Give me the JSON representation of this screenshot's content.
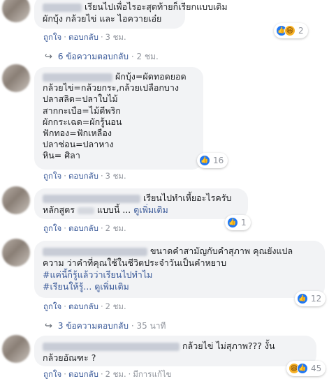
{
  "comments": [
    {
      "lines": [
        "เรียนไปเพื่อไรอะสุดท้ายก็เรียกแบบเดิม",
        "ผักบุ้ง กล้วยไข่ และ ไอควายเอ๋ย"
      ],
      "reactions": {
        "count": "2",
        "icons": [
          "like-icon",
          "haha-icon"
        ]
      },
      "meta": {
        "like": "ถูกใจ",
        "reply": "ตอบกลับ",
        "time": "3 ชม."
      }
    },
    {
      "lines": [
        "ผักบุ้ง=ผัดทอดยอด",
        "กล้วยไข่=กล้วยกระ,กล้วยเปลือกบาง",
        "ปลาสลิด=ปลาใบไม้",
        "สากกะเบือ=ไม้ตีพริก",
        "ผักกระเฉด=ผักรู้นอน",
        "ฟักทอง=ฟักเหลือง",
        "ปลาช่อน=ปลาหาง",
        "หิน= ศิลา"
      ],
      "reactions": {
        "count": "16",
        "icons": [
          "like-icon"
        ]
      },
      "meta": {
        "like": "ถูกใจ",
        "reply": "ตอบกลับ",
        "time": "3 ชม."
      }
    },
    {
      "lines": [
        "เรียนไปทำเหี้ยอะไรครับ",
        "หลักสูตร",
        "แบบนี้ ...",
        "ดูเพิ่มเติม"
      ],
      "reactions": {
        "count": "1",
        "icons": [
          "like-icon"
        ]
      },
      "meta": {
        "like": "ถูกใจ",
        "reply": "ตอบกลับ",
        "time": "2 ชม."
      }
    },
    {
      "lines": [
        "ขนาดคำสามัญกับคำสุภาพ คุณยังแปล",
        "ความ ว่าคำที่คุณใช้ในชีวิตประจำวันเป็นคำหยาบ",
        "#แค่นี้ก็รู้แล้วว่าเรียนไปทำไม",
        "#เรียนให้รู้...",
        "ดูเพิ่มเติม"
      ],
      "reactions": {
        "count": "12",
        "icons": [
          "like-icon"
        ]
      },
      "meta": {
        "like": "ถูกใจ",
        "reply": "ตอบกลับ",
        "time": "2 ชม."
      }
    },
    {
      "lines": [
        "กล้วยไข่ ไม่สุภาพ??? งั้น",
        "กล้วยอัณฑะ ?"
      ],
      "reactions": {
        "count": "45",
        "icons": [
          "haha-icon",
          "like-icon"
        ]
      },
      "meta": {
        "like": "ถูกใจ",
        "reply": "ตอบกลับ",
        "time": "2 ชม.",
        "edited": "มีการแก้ไข"
      }
    }
  ],
  "reply_threads": [
    {
      "text": "6 ข้อความตอบกลับ",
      "time": "2 ชม."
    },
    {
      "text": "3 ข้อความตอบกลับ",
      "time": "35 นาที"
    }
  ]
}
